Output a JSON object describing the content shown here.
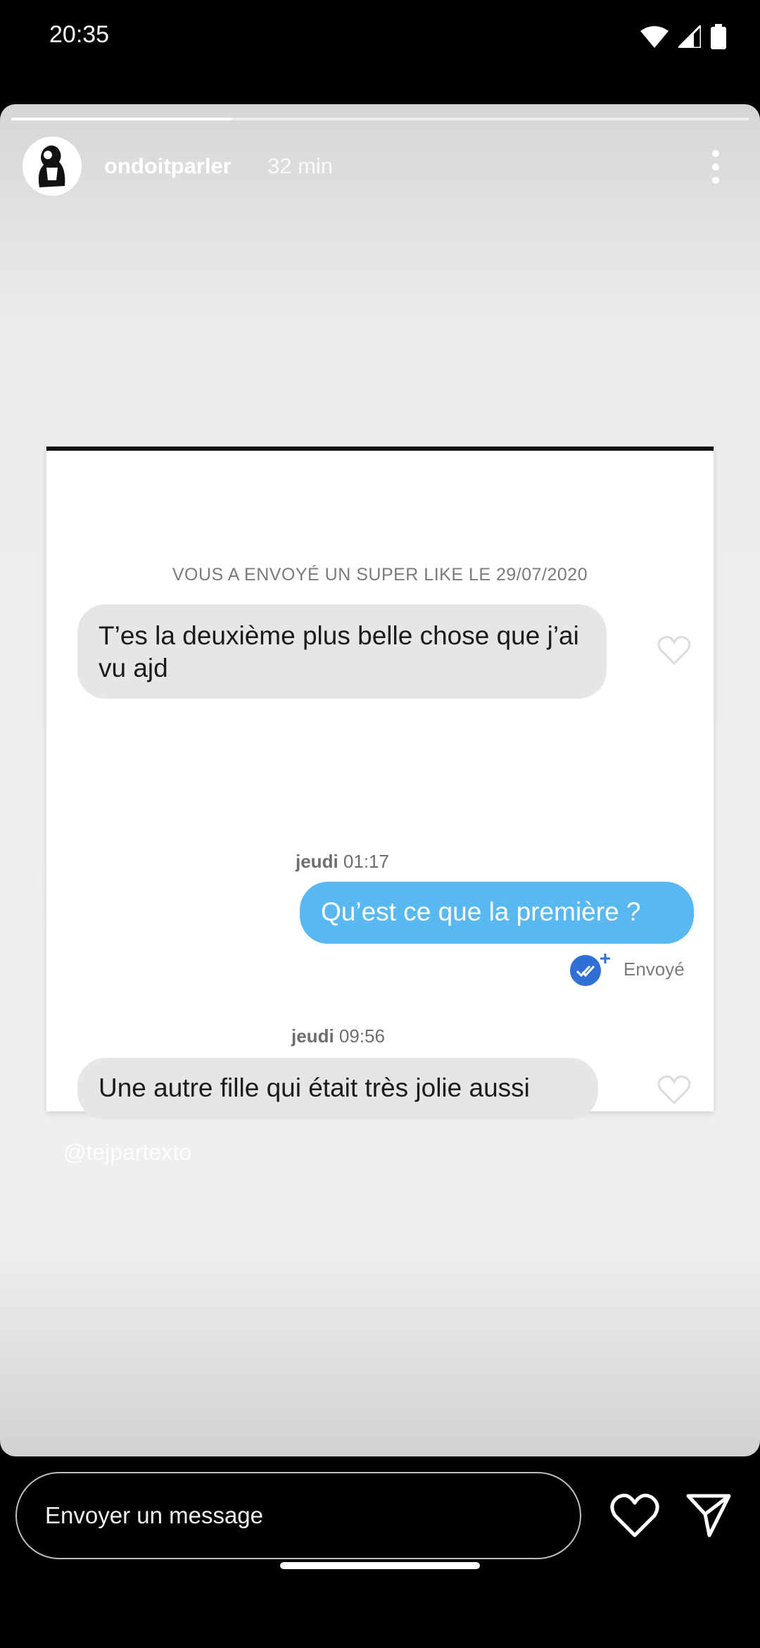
{
  "status_bar": {
    "time": "20:35"
  },
  "story": {
    "username": "ondoitparler",
    "time_ago": "32 min",
    "progress": 0.3,
    "watermark": "@tejpartexto",
    "chat": {
      "superlike_note": "VOUS A ENVOYÉ UN SUPER LIKE LE 29/07/2020",
      "message1": "T’es la deuxième plus belle chose que j’ai vu ajd",
      "stamp1_day": "jeudi",
      "stamp1_time": "01:17",
      "message2": "Qu’est ce que la première ?",
      "sent_status": "Envoyé",
      "stamp2_day": "jeudi",
      "stamp2_time": "09:56",
      "message3": "Une autre fille qui était très jolie aussi"
    }
  },
  "reply": {
    "placeholder": "Envoyer un message"
  },
  "colors": {
    "sent_bubble": "#5ab8f0",
    "received_bubble": "#e6e6e6",
    "read_check": "#2f6fd6"
  }
}
